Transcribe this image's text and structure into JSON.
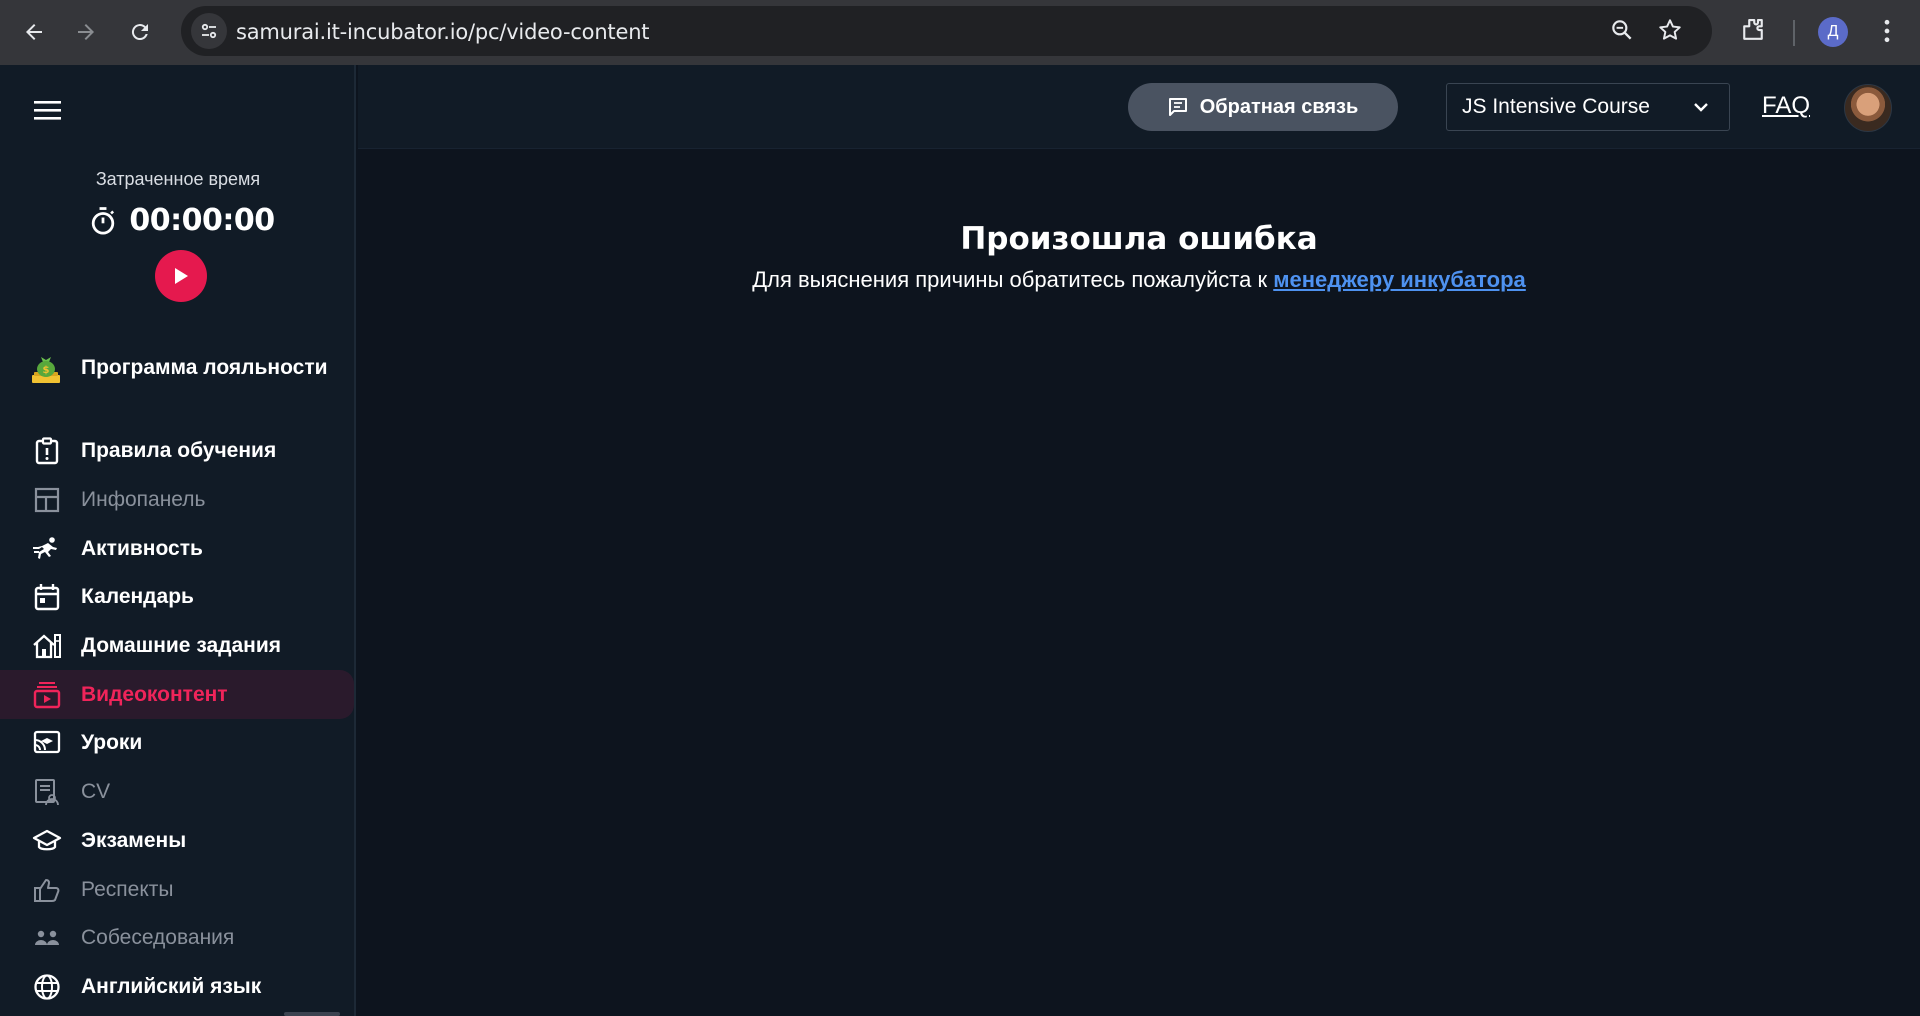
{
  "browser": {
    "url": "samurai.it-incubator.io/pc/video-content",
    "profile_initial": "Д",
    "icons": [
      "back-arrow-icon",
      "forward-arrow-icon",
      "reload-icon",
      "site-settings-icon",
      "zoom-icon",
      "bookmark-star-icon",
      "extensions-icon",
      "kebab-menu-icon"
    ]
  },
  "sidebar": {
    "timer_label": "Затраченное время",
    "timer_value": "00:00:00",
    "loyalty_label": "Программа лояльности",
    "items": [
      {
        "label": "Правила обучения",
        "icon": "rules-icon",
        "state": "normal"
      },
      {
        "label": "Инфопанель",
        "icon": "dashboard-icon",
        "state": "dim"
      },
      {
        "label": "Активность",
        "icon": "activity-icon",
        "state": "normal"
      },
      {
        "label": "Календарь",
        "icon": "calendar-icon",
        "state": "normal"
      },
      {
        "label": "Домашние задания",
        "icon": "homework-icon",
        "state": "normal"
      },
      {
        "label": "Видеоконтент",
        "icon": "video-icon",
        "state": "active"
      },
      {
        "label": "Уроки",
        "icon": "lessons-icon",
        "state": "normal"
      },
      {
        "label": "CV",
        "icon": "cv-icon",
        "state": "dim"
      },
      {
        "label": "Экзамены",
        "icon": "exams-icon",
        "state": "normal"
      },
      {
        "label": "Респекты",
        "icon": "thumbs-up-icon",
        "state": "dim"
      },
      {
        "label": "Собеседования",
        "icon": "interviews-icon",
        "state": "dim"
      },
      {
        "label": "Английский язык",
        "icon": "globe-icon",
        "state": "normal"
      }
    ]
  },
  "header": {
    "feedback_label": "Обратная связь",
    "course_selected": "JS Intensive Course",
    "faq_label": "FAQ"
  },
  "main": {
    "error_title": "Произошла ошибка",
    "error_text": "Для выяснения причины обратитесь пожалуйста к",
    "error_link": "менеджеру инкубатора"
  },
  "colors": {
    "accent": "#f0245a",
    "link": "#4e92f0",
    "background": "#0d141e",
    "sidebar": "#111b26"
  }
}
